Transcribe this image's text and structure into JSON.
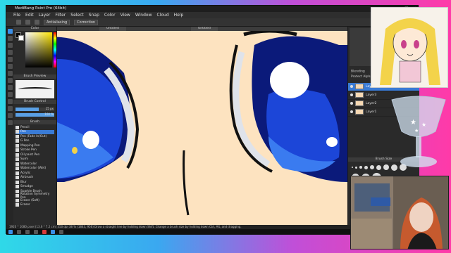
{
  "app": {
    "title": "MediBang Paint Pro (64bit)",
    "menu": [
      "File",
      "Edit",
      "Layer",
      "Filter",
      "Select",
      "Snap",
      "Color",
      "View",
      "Window",
      "Cloud",
      "Help"
    ],
    "toolbar_chips": [
      "Antialiasing",
      "Correction"
    ],
    "canvas_tabs": [
      "Untitled",
      "Untitled"
    ],
    "status_text": "1920 * 1080 pixel   (13.6 * 7.2 cm)   350 dpi   38 %   (1843, 956)   Draw a straight line by holding down Shift. Change a brush size by holding down Ctrl, Alt, and dragging."
  },
  "left_panel": {
    "color_title": "Color",
    "brush_preview_title": "Brush Preview",
    "brush_control_title": "Brush Control",
    "brush_title": "Brush",
    "brush_size_value": "15 px",
    "opacity_value": "100 %",
    "brushes": [
      "Pencil",
      "Pen",
      "Pen (Fade In/Out)",
      "G Pen",
      "Mapping Pen",
      "Stroke Pen",
      "Oil paint Pen",
      "Sumi",
      "Watercolor",
      "Watercolor (Wet)",
      "Acrylic",
      "Airbrush",
      "Blur",
      "Smudge",
      "Sparkle Brush",
      "Rotation Symmetry Pen",
      "Eraser (Soft)",
      "Eraser"
    ]
  },
  "right_panel": {
    "blending_label": "Blending",
    "blending_value": "Normal",
    "protect_label": "Protect Alpha",
    "layers": [
      "Layer4",
      "Layer3",
      "Layer2",
      "Layer1"
    ],
    "brush_size_title": "Brush Size"
  },
  "colors": {
    "skin": "#fde3c0",
    "iris_dark": "#0b1a7a",
    "iris_mid": "#1c46d8",
    "iris_light": "#3a7bf0",
    "outline": "#111111",
    "accent": "#3a7bd5"
  }
}
